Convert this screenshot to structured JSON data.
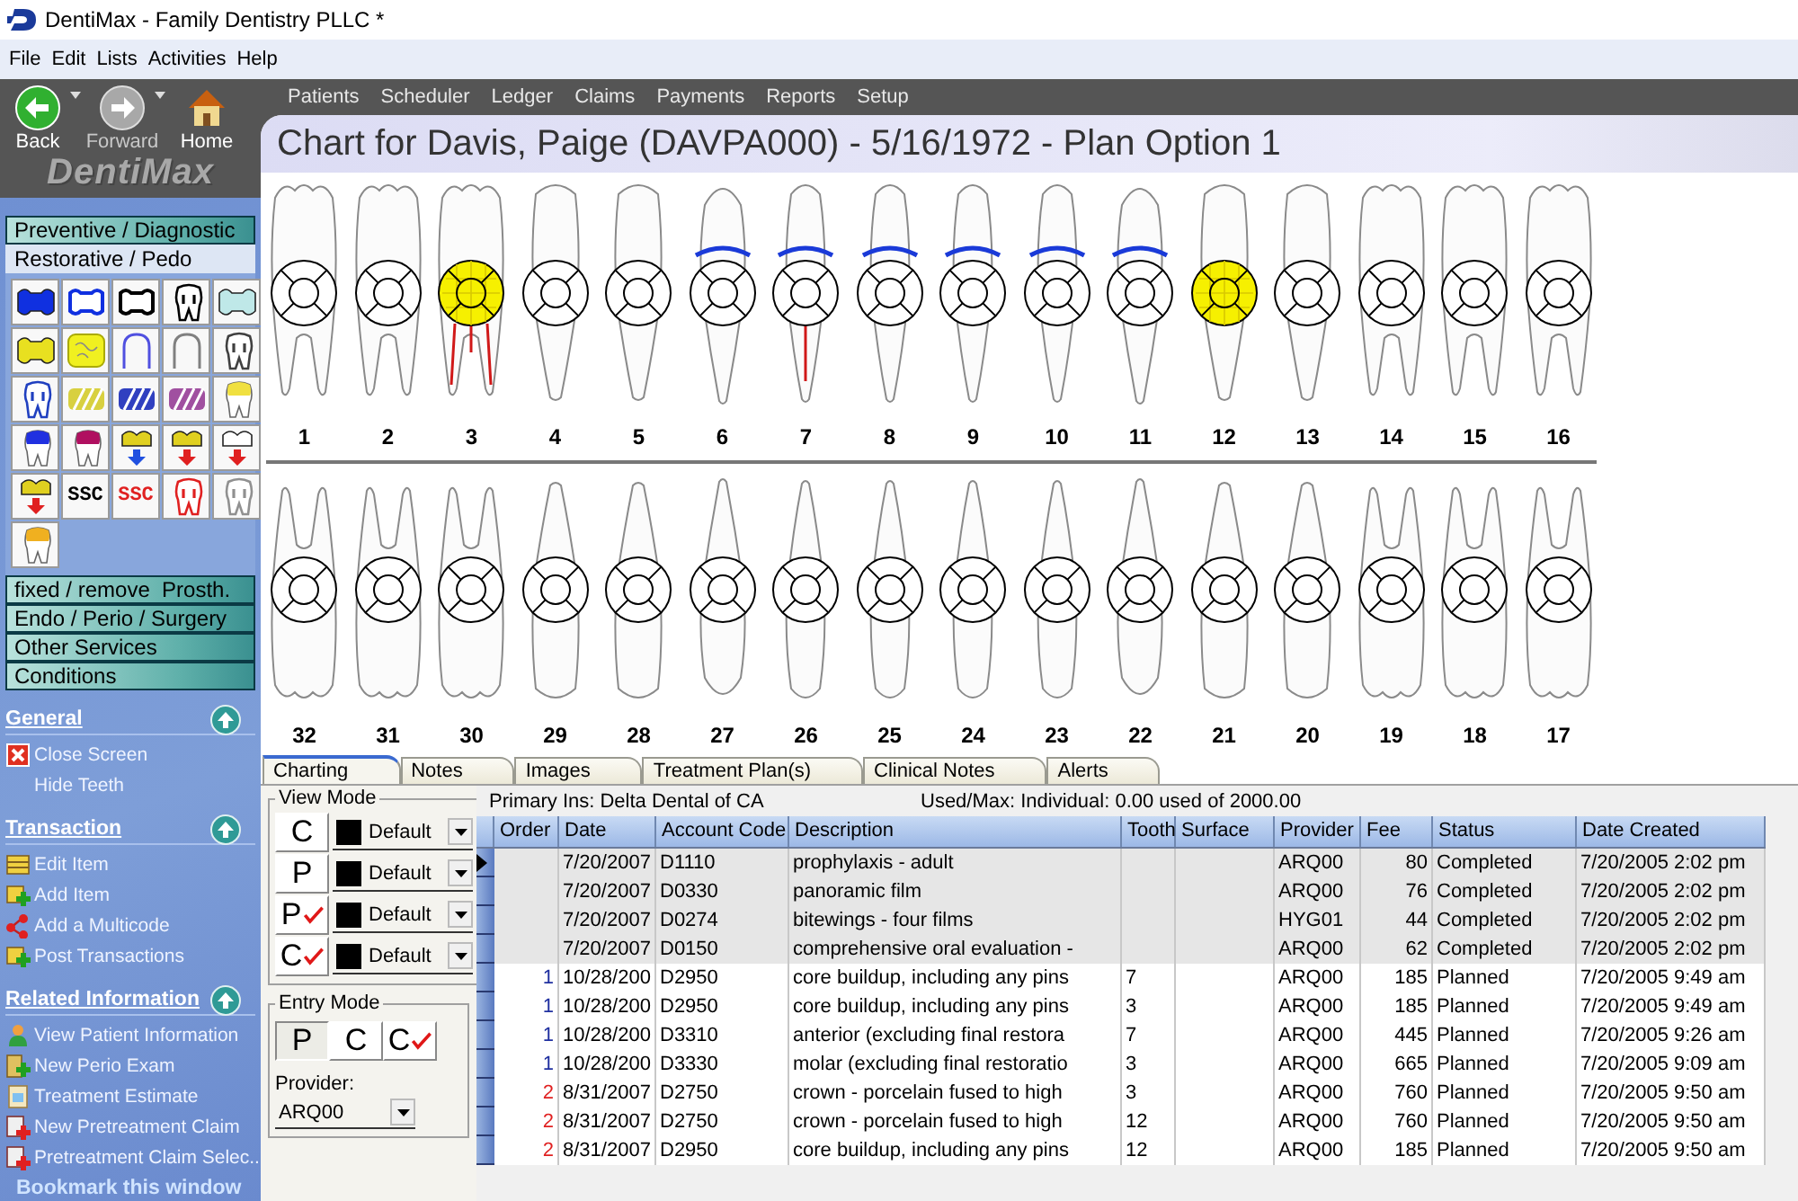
{
  "window": {
    "title": "DentiMax - Family Dentistry PLLC *"
  },
  "menu": [
    "File",
    "Edit",
    "Lists",
    "Activities",
    "Help"
  ],
  "nav_buttons": [
    {
      "label": "Back",
      "kind": "back",
      "disabled": false
    },
    {
      "label": "Forward",
      "kind": "forward",
      "disabled": true
    },
    {
      "label": "Home",
      "kind": "home",
      "disabled": false
    }
  ],
  "logo": "DentiMax",
  "top_nav": [
    "Patients",
    "Scheduler",
    "Ledger",
    "Claims",
    "Payments",
    "Reports",
    "Setup"
  ],
  "sidebar": {
    "categories": [
      {
        "label": "Preventive / Diagnostic",
        "expanded": false
      },
      {
        "label": "Restorative / Pedo",
        "expanded": true
      },
      {
        "label": "fixed / remove  Prosth.",
        "expanded": false
      },
      {
        "label": "Endo / Perio / Surgery",
        "expanded": false
      },
      {
        "label": "Other Services",
        "expanded": false
      },
      {
        "label": "Conditions",
        "expanded": false
      }
    ],
    "palette": [
      {
        "kind": "bridge",
        "color": "#1030e0"
      },
      {
        "kind": "bridge-outline",
        "color": "#1030e0"
      },
      {
        "kind": "bridge-outline",
        "color": "#000000"
      },
      {
        "kind": "tooth",
        "color": "#000000"
      },
      {
        "kind": "bridge",
        "color": "#bfe8e8"
      },
      {
        "kind": "bridge",
        "color": "#e8e020"
      },
      {
        "kind": "block",
        "color": "#f0f020"
      },
      {
        "kind": "arch",
        "color": "#5050e0"
      },
      {
        "kind": "arch",
        "color": "#808080"
      },
      {
        "kind": "tooth",
        "color": "#404040"
      },
      {
        "kind": "tooth",
        "color": "#2040c0"
      },
      {
        "kind": "hatch",
        "color": "#d8d040"
      },
      {
        "kind": "hatch",
        "color": "#3040c0"
      },
      {
        "kind": "hatch",
        "color": "#a050a0"
      },
      {
        "kind": "crown",
        "color": "#f0e040"
      },
      {
        "kind": "crown",
        "color": "#2030e0"
      },
      {
        "kind": "crown",
        "color": "#b01060"
      },
      {
        "kind": "cap-arrow",
        "color": "#e0d020",
        "arrow": {
          "color": "#2050e0"
        }
      },
      {
        "kind": "cap-arrow",
        "color": "#e0d020",
        "arrow": {
          "color": "#e02020"
        }
      },
      {
        "kind": "cap-arrow",
        "color": "#ffffff",
        "arrow": {
          "color": "#e02020"
        }
      },
      {
        "kind": "cap-arrow",
        "color": "#e0d020",
        "arrow": {
          "color": "#e02020"
        }
      },
      {
        "kind": "label",
        "text": "SSC",
        "color": "#000000"
      },
      {
        "kind": "label",
        "text": "SSC",
        "color": "#e02020"
      },
      {
        "kind": "tooth",
        "color": "#e02020"
      },
      {
        "kind": "tooth",
        "color": "#909090"
      },
      {
        "kind": "crown",
        "color": "#f0b020"
      }
    ],
    "sections": [
      {
        "title": "General",
        "expanded": true,
        "items": [
          {
            "label": "Close Screen",
            "kind": "close"
          },
          {
            "label": "Hide Teeth",
            "kind": "plain"
          }
        ]
      },
      {
        "title": "Transaction",
        "expanded": true,
        "items": [
          {
            "label": "Edit Item",
            "kind": "edit"
          },
          {
            "label": "Add Item",
            "kind": "add"
          },
          {
            "label": "Add a Multicode",
            "kind": "multicode"
          },
          {
            "label": "Post Transactions",
            "kind": "add"
          }
        ]
      },
      {
        "title": "Related Information",
        "expanded": true,
        "items": [
          {
            "label": "View Patient Information",
            "kind": "person"
          },
          {
            "label": "New Perio Exam",
            "kind": "perio"
          },
          {
            "label": "Treatment Estimate",
            "kind": "estimate"
          },
          {
            "label": "New Pretreatment Claim",
            "kind": "claim"
          },
          {
            "label": "Pretreatment Claim Selec...",
            "kind": "claim"
          }
        ]
      }
    ],
    "bookmark": "Bookmark this window"
  },
  "chart": {
    "title": "Chart for Davis, Paige (DAVPA000) - 5/16/1972 - Plan Option 1",
    "upper_teeth": [
      {
        "number": "1",
        "kind": "molar",
        "surface_fill": false,
        "root_canal": false,
        "crown_arc": false
      },
      {
        "number": "2",
        "kind": "molar",
        "surface_fill": false,
        "root_canal": false,
        "crown_arc": false
      },
      {
        "number": "3",
        "kind": "molar",
        "surface_fill": true,
        "root_canal": true,
        "crown_arc": false
      },
      {
        "number": "4",
        "kind": "premolar",
        "surface_fill": false,
        "root_canal": false,
        "crown_arc": false
      },
      {
        "number": "5",
        "kind": "premolar",
        "surface_fill": false,
        "root_canal": false,
        "crown_arc": false
      },
      {
        "number": "6",
        "kind": "canine",
        "surface_fill": false,
        "root_canal": false,
        "crown_arc": true
      },
      {
        "number": "7",
        "kind": "incisor",
        "surface_fill": false,
        "root_canal": true,
        "crown_arc": true
      },
      {
        "number": "8",
        "kind": "incisor",
        "surface_fill": false,
        "root_canal": false,
        "crown_arc": true
      },
      {
        "number": "9",
        "kind": "incisor",
        "surface_fill": false,
        "root_canal": false,
        "crown_arc": true
      },
      {
        "number": "10",
        "kind": "incisor",
        "surface_fill": false,
        "root_canal": false,
        "crown_arc": true
      },
      {
        "number": "11",
        "kind": "canine",
        "surface_fill": false,
        "root_canal": false,
        "crown_arc": true
      },
      {
        "number": "12",
        "kind": "premolar",
        "surface_fill": true,
        "root_canal": false,
        "crown_arc": false
      },
      {
        "number": "13",
        "kind": "premolar",
        "surface_fill": false,
        "root_canal": false,
        "crown_arc": false
      },
      {
        "number": "14",
        "kind": "molar",
        "surface_fill": false,
        "root_canal": false,
        "crown_arc": false
      },
      {
        "number": "15",
        "kind": "molar",
        "surface_fill": false,
        "root_canal": false,
        "crown_arc": false
      },
      {
        "number": "16",
        "kind": "molar",
        "surface_fill": false,
        "root_canal": false,
        "crown_arc": false
      }
    ],
    "lower_teeth": [
      {
        "number": "32",
        "kind": "molar",
        "surface_fill": false,
        "root_canal": false,
        "crown_arc": false
      },
      {
        "number": "31",
        "kind": "molar",
        "surface_fill": false,
        "root_canal": false,
        "crown_arc": false
      },
      {
        "number": "30",
        "kind": "molar",
        "surface_fill": false,
        "root_canal": false,
        "crown_arc": false
      },
      {
        "number": "29",
        "kind": "premolar",
        "surface_fill": false,
        "root_canal": false,
        "crown_arc": false
      },
      {
        "number": "28",
        "kind": "premolar",
        "surface_fill": false,
        "root_canal": false,
        "crown_arc": false
      },
      {
        "number": "27",
        "kind": "canine",
        "surface_fill": false,
        "root_canal": false,
        "crown_arc": false
      },
      {
        "number": "26",
        "kind": "incisor",
        "surface_fill": false,
        "root_canal": false,
        "crown_arc": false
      },
      {
        "number": "25",
        "kind": "incisor",
        "surface_fill": false,
        "root_canal": false,
        "crown_arc": false
      },
      {
        "number": "24",
        "kind": "incisor",
        "surface_fill": false,
        "root_canal": false,
        "crown_arc": false
      },
      {
        "number": "23",
        "kind": "incisor",
        "surface_fill": false,
        "root_canal": false,
        "crown_arc": false
      },
      {
        "number": "22",
        "kind": "canine",
        "surface_fill": false,
        "root_canal": false,
        "crown_arc": false
      },
      {
        "number": "21",
        "kind": "premolar",
        "surface_fill": false,
        "root_canal": false,
        "crown_arc": false
      },
      {
        "number": "20",
        "kind": "premolar",
        "surface_fill": false,
        "root_canal": false,
        "crown_arc": false
      },
      {
        "number": "19",
        "kind": "molar",
        "surface_fill": false,
        "root_canal": false,
        "crown_arc": false
      },
      {
        "number": "18",
        "kind": "molar",
        "surface_fill": false,
        "root_canal": false,
        "crown_arc": false
      },
      {
        "number": "17",
        "kind": "molar",
        "surface_fill": false,
        "root_canal": false,
        "crown_arc": false
      }
    ]
  },
  "tabs": [
    {
      "label": "Charting",
      "selected": true
    },
    {
      "label": "Notes",
      "selected": false
    },
    {
      "label": "Images",
      "selected": false
    },
    {
      "label": "Treatment Plan(s)",
      "selected": false
    },
    {
      "label": "Clinical Notes",
      "selected": false
    },
    {
      "label": "Alerts",
      "selected": false
    }
  ],
  "view_mode": {
    "title": "View Mode",
    "rows": [
      {
        "letter": "C",
        "with_check": false,
        "color": "#000000",
        "value": "Default"
      },
      {
        "letter": "P",
        "with_check": false,
        "color": "#000000",
        "value": "Default"
      },
      {
        "letter": "P",
        "with_check": true,
        "color": "#000000",
        "value": "Default"
      },
      {
        "letter": "C",
        "with_check": true,
        "color": "#000000",
        "value": "Default"
      }
    ]
  },
  "entry_mode": {
    "title": "Entry Mode",
    "buttons": [
      {
        "letter": "P",
        "with_check": false,
        "selected": true
      },
      {
        "letter": "C",
        "with_check": false,
        "selected": false
      },
      {
        "letter": "C",
        "with_check": true,
        "selected": false
      }
    ],
    "provider_label": "Provider:",
    "provider": "ARQ00"
  },
  "table": {
    "insurance": "Primary Ins: Delta Dental of CA",
    "benefits": "Used/Max:  Individual: 0.00 used of 2000.00",
    "columns": [
      "Order",
      "Date",
      "Account Code",
      "Description",
      "Tooth",
      "Surface",
      "Provider",
      "Fee",
      "Status",
      "Date Created"
    ],
    "rows": [
      {
        "selected": true,
        "highlighted": true,
        "date": "7/20/2007",
        "code": "D1110",
        "description": "prophylaxis - adult",
        "provider": "ARQ00",
        "fee": "80",
        "status": "Completed",
        "created": "7/20/2005 2:02 pm"
      },
      {
        "selected": false,
        "highlighted": true,
        "date": "7/20/2007",
        "code": "D0330",
        "description": "panoramic film",
        "provider": "ARQ00",
        "fee": "76",
        "status": "Completed",
        "created": "7/20/2005 2:02 pm"
      },
      {
        "selected": false,
        "highlighted": true,
        "date": "7/20/2007",
        "code": "D0274",
        "description": "bitewings - four films",
        "provider": "HYG01",
        "fee": "44",
        "status": "Completed",
        "created": "7/20/2005 2:02 pm"
      },
      {
        "selected": false,
        "highlighted": true,
        "date": "7/20/2007",
        "code": "D0150",
        "description": "comprehensive oral evaluation -",
        "provider": "ARQ00",
        "fee": "62",
        "status": "Completed",
        "created": "7/20/2005 2:02 pm"
      },
      {
        "selected": false,
        "highlighted": false,
        "order": "1",
        "color": "#2030a0",
        "date": "10/28/200",
        "code": "D2950",
        "description": "core buildup, including any pins",
        "tooth": "7",
        "provider": "ARQ00",
        "fee": "185",
        "status": "Planned",
        "created": "7/20/2005 9:49 am"
      },
      {
        "selected": false,
        "highlighted": false,
        "order": "1",
        "color": "#2030a0",
        "date": "10/28/200",
        "code": "D2950",
        "description": "core buildup, including any pins",
        "tooth": "3",
        "provider": "ARQ00",
        "fee": "185",
        "status": "Planned",
        "created": "7/20/2005 9:49 am"
      },
      {
        "selected": false,
        "highlighted": false,
        "order": "1",
        "color": "#2030a0",
        "date": "10/28/200",
        "code": "D3310",
        "description": "anterior (excluding final restora",
        "tooth": "7",
        "provider": "ARQ00",
        "fee": "445",
        "status": "Planned",
        "created": "7/20/2005 9:26 am"
      },
      {
        "selected": false,
        "highlighted": false,
        "order": "1",
        "color": "#2030a0",
        "date": "10/28/200",
        "code": "D3330",
        "description": "molar (excluding final restoratio",
        "tooth": "3",
        "provider": "ARQ00",
        "fee": "665",
        "status": "Planned",
        "created": "7/20/2005 9:09 am"
      },
      {
        "selected": false,
        "highlighted": false,
        "order": "2",
        "color": "#e02020",
        "date": "8/31/2007",
        "code": "D2750",
        "description": "crown - porcelain fused to high",
        "tooth": "3",
        "provider": "ARQ00",
        "fee": "760",
        "status": "Planned",
        "created": "7/20/2005 9:50 am"
      },
      {
        "selected": false,
        "highlighted": false,
        "order": "2",
        "color": "#e02020",
        "date": "8/31/2007",
        "code": "D2750",
        "description": "crown - porcelain fused to high",
        "tooth": "12",
        "provider": "ARQ00",
        "fee": "760",
        "status": "Planned",
        "created": "7/20/2005 9:50 am"
      },
      {
        "selected": false,
        "highlighted": false,
        "order": "2",
        "color": "#e02020",
        "date": "8/31/2007",
        "code": "D2950",
        "description": "core buildup, including any pins",
        "tooth": "12",
        "provider": "ARQ00",
        "fee": "185",
        "status": "Planned",
        "created": "7/20/2005 9:50 am"
      }
    ]
  }
}
